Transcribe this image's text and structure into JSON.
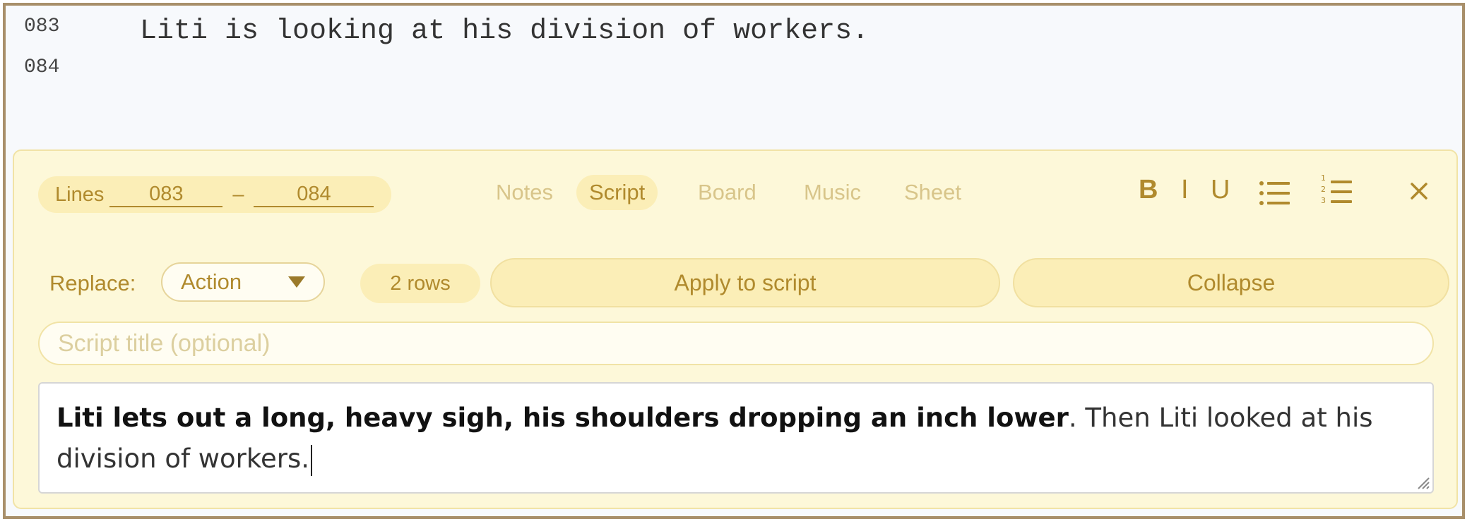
{
  "script_lines": [
    {
      "number": "083",
      "text": "Liti is looking at his division of workers."
    },
    {
      "number": "084",
      "text": ""
    }
  ],
  "panel": {
    "lines_label": "Lines",
    "line_start": "083",
    "line_end": "084",
    "dash": "–",
    "tabs": [
      "Notes",
      "Script",
      "Board",
      "Music",
      "Sheet"
    ],
    "active_tab": "Script",
    "format": {
      "bold": "B",
      "italic": "I",
      "underline": "U"
    },
    "replace_label": "Replace:",
    "replace_value": "Action",
    "rows_badge": "2 rows",
    "apply_label": "Apply to script",
    "collapse_label": "Collapse",
    "title_placeholder": "Script title (optional)",
    "editor_bold": "Liti lets out a long, heavy sigh, his shoulders dropping an inch lower",
    "editor_rest": ". Then Liti looked at his division of workers."
  },
  "icons": [
    "bullet-list-icon",
    "numbered-list-icon",
    "close-icon",
    "chevron-down-icon",
    "resize-handle-icon"
  ],
  "colors": {
    "accent": "#b08a2d",
    "panel_bg": "#fdf8d9",
    "pill_bg": "#fbeeb7",
    "frame_border": "#a88f6a"
  }
}
